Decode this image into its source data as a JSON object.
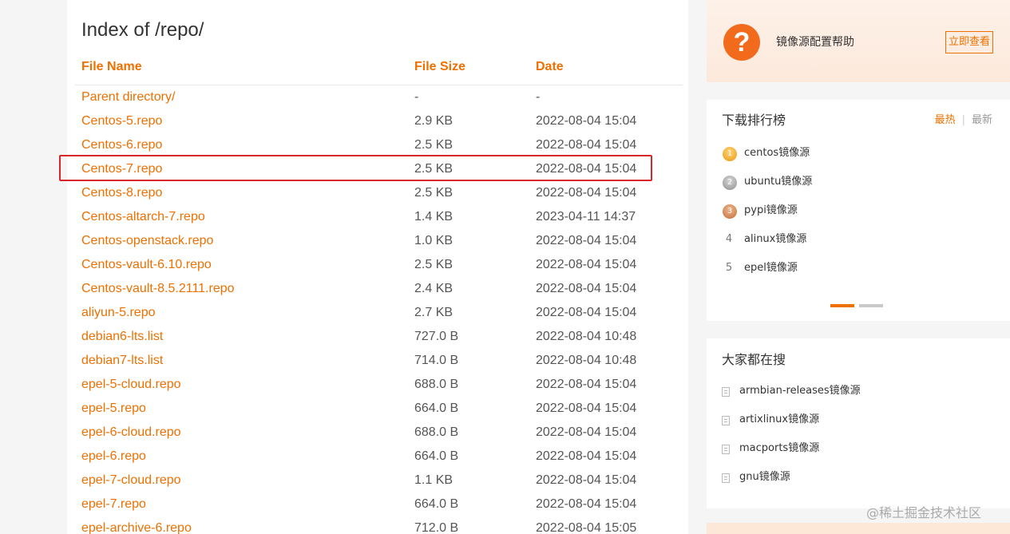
{
  "listing": {
    "title": "Index of /repo/",
    "columns": {
      "name": "File Name",
      "size": "File Size",
      "date": "Date"
    },
    "rows": [
      {
        "name": "Parent directory/",
        "size": "-",
        "date": "-"
      },
      {
        "name": "Centos-5.repo",
        "size": "2.9 KB",
        "date": "2022-08-04 15:04"
      },
      {
        "name": "Centos-6.repo",
        "size": "2.5 KB",
        "date": "2022-08-04 15:04"
      },
      {
        "name": "Centos-7.repo",
        "size": "2.5 KB",
        "date": "2022-08-04 15:04"
      },
      {
        "name": "Centos-8.repo",
        "size": "2.5 KB",
        "date": "2022-08-04 15:04"
      },
      {
        "name": "Centos-altarch-7.repo",
        "size": "1.4 KB",
        "date": "2023-04-11 14:37"
      },
      {
        "name": "Centos-openstack.repo",
        "size": "1.0 KB",
        "date": "2022-08-04 15:04"
      },
      {
        "name": "Centos-vault-6.10.repo",
        "size": "2.5 KB",
        "date": "2022-08-04 15:04"
      },
      {
        "name": "Centos-vault-8.5.2111.repo",
        "size": "2.4 KB",
        "date": "2022-08-04 15:04"
      },
      {
        "name": "aliyun-5.repo",
        "size": "2.7 KB",
        "date": "2022-08-04 15:04"
      },
      {
        "name": "debian6-lts.list",
        "size": "727.0 B",
        "date": "2022-08-04 10:48"
      },
      {
        "name": "debian7-lts.list",
        "size": "714.0 B",
        "date": "2022-08-04 10:48"
      },
      {
        "name": "epel-5-cloud.repo",
        "size": "688.0 B",
        "date": "2022-08-04 15:04"
      },
      {
        "name": "epel-5.repo",
        "size": "664.0 B",
        "date": "2022-08-04 15:04"
      },
      {
        "name": "epel-6-cloud.repo",
        "size": "688.0 B",
        "date": "2022-08-04 15:04"
      },
      {
        "name": "epel-6.repo",
        "size": "664.0 B",
        "date": "2022-08-04 15:04"
      },
      {
        "name": "epel-7-cloud.repo",
        "size": "1.1 KB",
        "date": "2022-08-04 15:04"
      },
      {
        "name": "epel-7.repo",
        "size": "664.0 B",
        "date": "2022-08-04 15:04"
      },
      {
        "name": "epel-archive-6.repo",
        "size": "712.0 B",
        "date": "2022-08-04 15:05"
      }
    ]
  },
  "help": {
    "icon": "question-icon",
    "icon_glyph": "?",
    "text": "镜像源配置帮助",
    "button": "立即查看"
  },
  "ranking": {
    "title": "下载排行榜",
    "tabs": {
      "hot": "最热",
      "new": "最新"
    },
    "items": [
      {
        "rank": "1",
        "label": "centos镜像源"
      },
      {
        "rank": "2",
        "label": "ubuntu镜像源"
      },
      {
        "rank": "3",
        "label": "pypi镜像源"
      },
      {
        "rank": "4",
        "label": "alinux镜像源"
      },
      {
        "rank": "5",
        "label": "epel镜像源"
      }
    ]
  },
  "searches": {
    "title": "大家都在搜",
    "items": [
      {
        "label": "armbian-releases镜像源"
      },
      {
        "label": "artixlinux镜像源"
      },
      {
        "label": "macports镜像源"
      },
      {
        "label": "gnu镜像源"
      }
    ]
  },
  "watermark": "@稀土掘金技术社区",
  "colors": {
    "accent": "#ee7000",
    "highlight": "#d8262d"
  }
}
